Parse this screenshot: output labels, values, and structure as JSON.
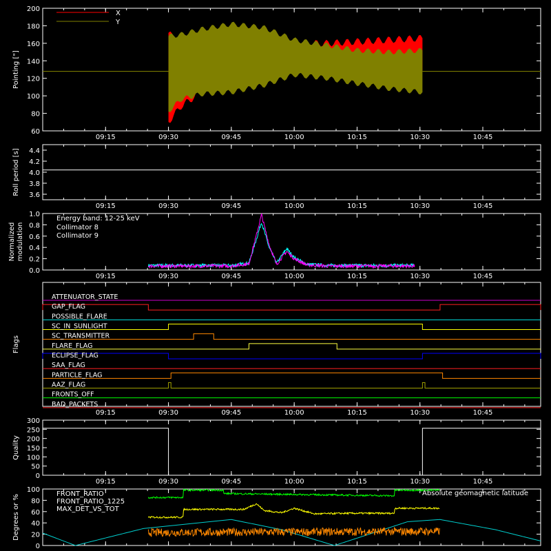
{
  "chart_data": [
    {
      "type": "area",
      "panel": "pointing",
      "ylabel": "Pointing [\"]",
      "ylim": [
        60,
        200
      ],
      "yticks": [
        60,
        80,
        100,
        120,
        140,
        160,
        180,
        200
      ],
      "xticks": [
        "09:15",
        "09:30",
        "09:45",
        "10:00",
        "10:15",
        "10:30",
        "10:45"
      ],
      "xlim": [
        9.0,
        10.98
      ],
      "legend": [
        {
          "label": "X",
          "color": "#ff0000"
        },
        {
          "label": "Y",
          "color": "#808000"
        }
      ],
      "baseline": 128,
      "series": [
        {
          "name": "X",
          "color": "#ff0000",
          "x": [
            9.5,
            9.55,
            9.63,
            9.75,
            9.88,
            10.0,
            10.13,
            10.25,
            10.38,
            10.51
          ],
          "ymax": [
            172,
            158,
            152,
            152,
            154,
            160,
            160,
            162,
            164,
            166
          ],
          "ymin": [
            70,
            88,
            104,
            112,
            118,
            128,
            130,
            129,
            129,
            129
          ]
        },
        {
          "name": "Y",
          "color": "#808000",
          "x": [
            9.5,
            9.55,
            9.63,
            9.75,
            9.88,
            10.0,
            10.13,
            10.25,
            10.38,
            10.51
          ],
          "ymax": [
            168,
            170,
            176,
            182,
            178,
            164,
            158,
            152,
            150,
            152
          ],
          "ymin": [
            82,
            96,
            102,
            104,
            112,
            124,
            120,
            114,
            108,
            104
          ]
        }
      ]
    },
    {
      "type": "line",
      "panel": "roll-period",
      "ylabel": "Roll period [s]",
      "ylim": [
        3.5,
        4.5
      ],
      "yticks": [
        3.6,
        3.8,
        4.0,
        4.2,
        4.4
      ],
      "xticks": [
        "09:15",
        "09:30",
        "09:45",
        "10:00",
        "10:15",
        "10:30",
        "10:45"
      ],
      "series": [
        {
          "name": "Roll period",
          "color": "#ffffff",
          "x": [
            9.0,
            10.98
          ],
          "y": [
            4.04,
            4.04
          ]
        }
      ]
    },
    {
      "type": "line",
      "panel": "modulation",
      "ylabel": "Normalized modulation",
      "ylim": [
        0,
        1.0
      ],
      "yticks": [
        "0.0",
        "0.2",
        "0.4",
        "0.6",
        "0.8",
        "1.0"
      ],
      "xticks": [
        "09:15",
        "09:30",
        "09:45",
        "10:00",
        "10:15",
        "10:30",
        "10:45"
      ],
      "legend_title": "Energy band: 12-25 keV",
      "series": [
        {
          "name": "Collimator 8",
          "color": "#00ffff",
          "x": [
            9.42,
            9.5,
            9.63,
            9.75,
            9.82,
            9.85,
            9.87,
            9.9,
            9.93,
            9.97,
            10.0,
            10.05,
            10.13,
            10.25,
            10.38,
            10.48
          ],
          "y": [
            0.08,
            0.08,
            0.08,
            0.08,
            0.12,
            0.55,
            0.85,
            0.4,
            0.12,
            0.38,
            0.22,
            0.1,
            0.08,
            0.08,
            0.08,
            0.08
          ]
        },
        {
          "name": "Collimator 9",
          "color": "#ff00ff",
          "x": [
            9.42,
            9.5,
            9.63,
            9.75,
            9.82,
            9.85,
            9.87,
            9.9,
            9.93,
            9.97,
            10.0,
            10.05,
            10.13,
            10.25,
            10.38,
            10.48
          ],
          "y": [
            0.07,
            0.07,
            0.07,
            0.07,
            0.11,
            0.62,
            0.98,
            0.45,
            0.1,
            0.33,
            0.2,
            0.09,
            0.07,
            0.07,
            0.07,
            0.07
          ]
        }
      ]
    },
    {
      "type": "line",
      "panel": "flags",
      "ylabel": "Flags",
      "xticks": [
        "09:15",
        "09:30",
        "09:45",
        "10:00",
        "10:15",
        "10:30",
        "10:45"
      ],
      "flags": [
        {
          "name": "ATTENUATOR_STATE",
          "color": "#cc00cc",
          "on": []
        },
        {
          "name": "GAP_FLAG",
          "color": "#ff2020",
          "on": [
            [
              9.0,
              9.42
            ],
            [
              10.58,
              10.98
            ]
          ]
        },
        {
          "name": "POSSIBLE_FLARE",
          "color": "#00e0e0",
          "on": []
        },
        {
          "name": "SC_IN_SUNLIGHT",
          "color": "#ffff00",
          "on": [
            [
              9.5,
              10.51
            ]
          ]
        },
        {
          "name": "SC_TRANSMITTER",
          "color": "#ff8800",
          "on": [
            [
              9.6,
              9.68
            ]
          ]
        },
        {
          "name": "FLARE_FLAG",
          "color": "#ffff40",
          "on": [
            [
              9.82,
              10.17
            ]
          ]
        },
        {
          "name": "ECLIPSE_FLAG",
          "color": "#0000ff",
          "on": [
            [
              9.0,
              9.5
            ],
            [
              10.51,
              10.98
            ]
          ]
        },
        {
          "name": "SAA_FLAG",
          "color": "#ff2020",
          "on": []
        },
        {
          "name": "PARTICLE_FLAG",
          "color": "#ff8800",
          "on": [
            [
              9.51,
              10.59
            ]
          ]
        },
        {
          "name": "AAZ_FLAG",
          "color": "#a0a000",
          "on": [
            [
              9.5,
              9.51
            ],
            [
              10.51,
              10.52
            ]
          ]
        },
        {
          "name": "FRONTS_OFF",
          "color": "#00ff00",
          "on": []
        },
        {
          "name": "BAD_PACKETS",
          "color": "#ff2020",
          "on": []
        }
      ]
    },
    {
      "type": "line",
      "panel": "quality",
      "ylabel": "Quality",
      "ylim": [
        0,
        300
      ],
      "yticks": [
        0,
        50,
        100,
        150,
        200,
        250,
        300
      ],
      "xticks": [
        "09:15",
        "09:30",
        "09:45",
        "10:00",
        "10:15",
        "10:30",
        "10:45"
      ],
      "series": [
        {
          "name": "Quality",
          "color": "#ffffff",
          "x": [
            9.0,
            9.5,
            9.5,
            10.51,
            10.51,
            10.98
          ],
          "y": [
            256,
            256,
            0,
            0,
            256,
            256
          ]
        }
      ]
    },
    {
      "type": "line",
      "panel": "ratios",
      "ylabel": "Degrees or %",
      "ylim": [
        0,
        100
      ],
      "yticks": [
        0,
        20,
        40,
        60,
        80,
        100
      ],
      "xticks": [
        "09:15",
        "09:30",
        "09:45",
        "10:00",
        "10:15",
        "10:30",
        "10:45"
      ],
      "series": [
        {
          "name": "FRONT_RATIO",
          "color": "#ffff00",
          "x": [
            9.42,
            9.56,
            9.56,
            9.8,
            9.85,
            9.88,
            9.95,
            10.0,
            10.08,
            10.2,
            10.4,
            10.4,
            10.58
          ],
          "y": [
            50,
            50,
            64,
            64,
            74,
            62,
            58,
            66,
            56,
            57,
            57,
            66,
            66
          ]
        },
        {
          "name": "FRONT_RATIO_1225",
          "color": "#00ff00",
          "x": [
            9.42,
            9.56,
            9.56,
            9.72,
            9.72,
            10.4,
            10.4,
            10.58
          ],
          "y": [
            85,
            85,
            98,
            98,
            92,
            88,
            98,
            98
          ]
        },
        {
          "name": "MAX_DET_VS_TOT",
          "color": "#ff8800",
          "x": [
            9.42,
            10.58
          ],
          "y": [
            23,
            25
          ]
        },
        {
          "name": "Absolute geomagnetic latitude",
          "color": "#00d0d0",
          "x": [
            9.0,
            9.13,
            9.4,
            9.75,
            9.95,
            10.16,
            10.45,
            10.58,
            10.8,
            10.98
          ],
          "y": [
            22,
            0,
            30,
            46,
            28,
            0,
            42,
            46,
            28,
            8
          ]
        }
      ]
    }
  ]
}
